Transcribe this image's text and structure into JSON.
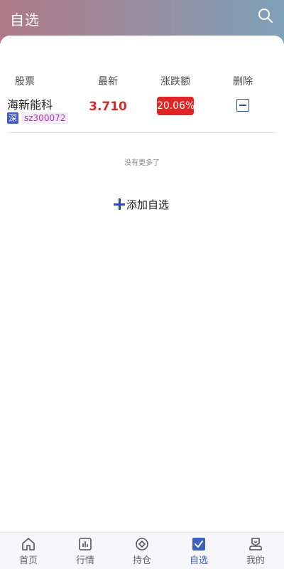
{
  "header": {
    "title": "自选"
  },
  "table": {
    "columns": [
      "股票",
      "最新",
      "涨跌额",
      "删除"
    ],
    "rows": [
      {
        "name": "海新能科",
        "market": "深",
        "code": "sz300072",
        "price": "3.710",
        "change": "20.06%"
      }
    ]
  },
  "no_more": "没有更多了",
  "add_label": "添加自选",
  "tabs": [
    {
      "label": "首页",
      "icon": "home-icon"
    },
    {
      "label": "行情",
      "icon": "market-chart-icon"
    },
    {
      "label": "持仓",
      "icon": "position-icon"
    },
    {
      "label": "自选",
      "icon": "checkbox-icon"
    },
    {
      "label": "我的",
      "icon": "user-icon"
    }
  ],
  "colors": {
    "accent": "#3f5ec0",
    "up_red": "#e02525",
    "code_purple": "#b23ab5"
  }
}
